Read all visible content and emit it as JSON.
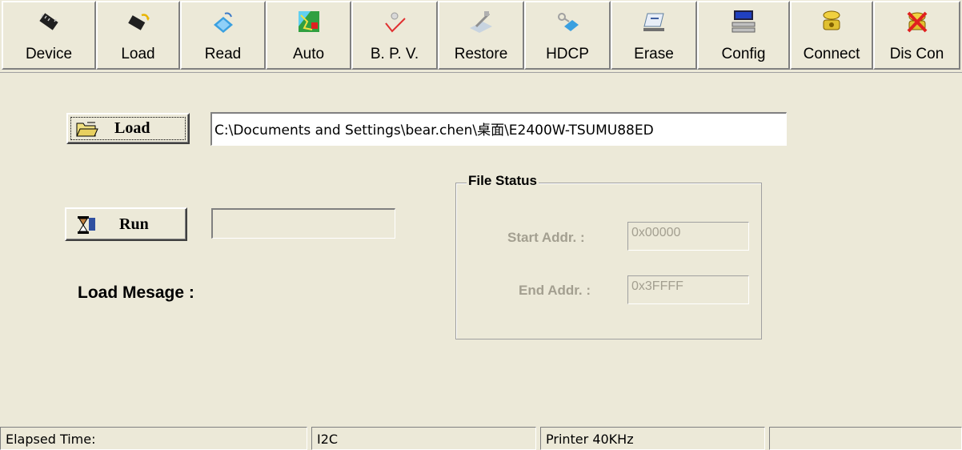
{
  "toolbar": {
    "buttons": [
      {
        "label": "Device",
        "icon": "device-chip-icon"
      },
      {
        "label": "Load",
        "icon": "load-chip-icon"
      },
      {
        "label": "Read",
        "icon": "read-book-icon"
      },
      {
        "label": "Auto",
        "icon": "auto-map-icon"
      },
      {
        "label": "B. P. V.",
        "icon": "checkmark-icon"
      },
      {
        "label": "Restore",
        "icon": "restore-icon"
      },
      {
        "label": "HDCP",
        "icon": "hdcp-key-icon"
      },
      {
        "label": "Erase",
        "icon": "erase-icon"
      },
      {
        "label": "Config",
        "icon": "computer-icon"
      },
      {
        "label": "Connect",
        "icon": "telephone-icon"
      },
      {
        "label": "Dis Con",
        "icon": "disconnect-phone-icon"
      }
    ]
  },
  "main": {
    "load_button_label": "Load",
    "file_path": "C:\\Documents and Settings\\bear.chen\\桌面\\E2400W-TSUMU88ED",
    "run_button_label": "Run",
    "run_progress": "",
    "load_message_label": "Load Mesage :"
  },
  "file_status": {
    "title": "File Status",
    "start_label": "Start Addr. :",
    "start_value": "0x00000",
    "end_label": "End Addr. :",
    "end_value": "0x3FFFF"
  },
  "statusbar": {
    "elapsed": "Elapsed Time:",
    "interface": "I2C",
    "port": "Printer  40KHz",
    "extra": ""
  },
  "colors": {
    "window_bg": "#ece9d8",
    "disabled_text": "#a39f90"
  }
}
